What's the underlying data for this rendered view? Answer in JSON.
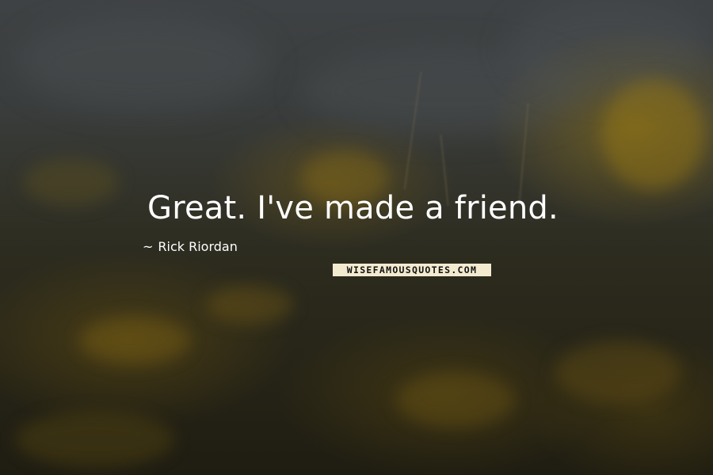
{
  "quote": {
    "text": "Great. I've made a friend.",
    "author": "Rick Riordan",
    "author_prefix": "~"
  },
  "watermark": {
    "text": "WISEFAMOUSQUOTES.COM"
  },
  "colors": {
    "text": "#ffffff",
    "watermark_bg": "#f3ead0",
    "meadow": "#6b5512",
    "sky": "#3f4244"
  }
}
